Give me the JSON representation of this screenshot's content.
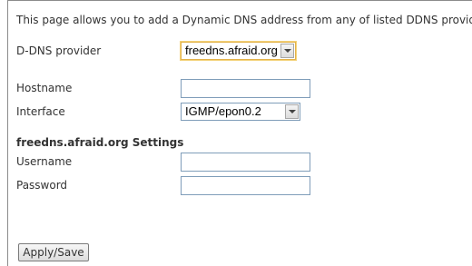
{
  "intro_text": "This page allows you to add a Dynamic DNS address from any of listed DDNS providers.",
  "form": {
    "provider": {
      "label": "D-DNS provider",
      "value": "freedns.afraid.org"
    },
    "hostname": {
      "label": "Hostname",
      "value": ""
    },
    "interface": {
      "label": "Interface",
      "value": "IGMP/epon0.2"
    }
  },
  "settings": {
    "heading": "freedns.afraid.org Settings",
    "username": {
      "label": "Username",
      "value": ""
    },
    "password": {
      "label": "Password",
      "value": ""
    }
  },
  "apply_button": {
    "label": "Apply/Save"
  },
  "colors": {
    "focus_border": "#e3b24a",
    "input_border": "#7f9db9",
    "text": "#333333"
  },
  "icons": {
    "dropdown": "chevron-down-icon"
  }
}
